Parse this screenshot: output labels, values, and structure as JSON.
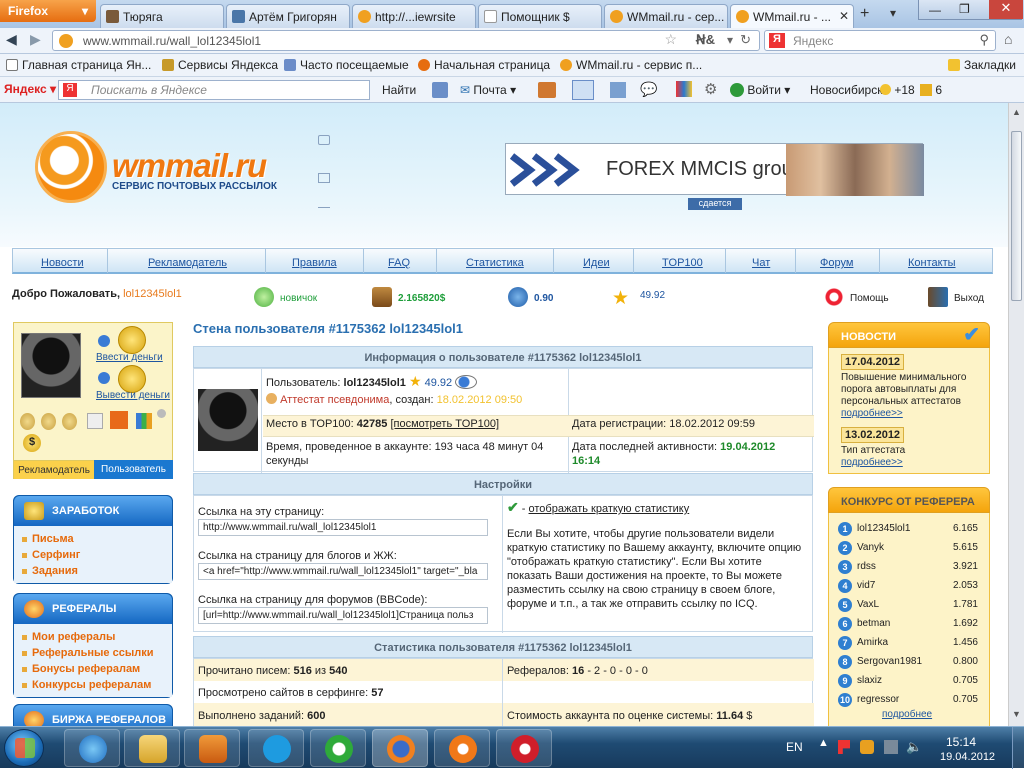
{
  "browser": {
    "app_button": "Firefox",
    "tabs": [
      {
        "label": "Тюряга",
        "icon_color": "#7a5a3a"
      },
      {
        "label": "Артём Григорян",
        "icon_color": "#4a76a8"
      },
      {
        "label": "http://...iewrsite",
        "icon_color": "#f0a020"
      },
      {
        "label": "Помощник $",
        "icon_color": "#ffffff"
      },
      {
        "label": "WMmail.ru - сер...",
        "icon_color": "#f0a020"
      },
      {
        "label": "WMmail.ru - ...",
        "icon_color": "#f0a020"
      }
    ],
    "url": "www.wmmail.ru/wall_lol12345lol1",
    "search_placeholder": "Яндекс",
    "bookmarks": [
      "Главная страница Ян...",
      "Сервисы Яндекса",
      "Часто посещаемые",
      "Начальная страница",
      "WMmail.ru - сервис п...",
      "Закладки"
    ],
    "yandex_bar": {
      "brand": "Яндекс",
      "search_placeholder": "Поискать в Яндексе",
      "find": "Найти",
      "mail": "Почта",
      "login": "Войти",
      "city": "Новосибирск",
      "temperature": "+18",
      "count": "6"
    }
  },
  "site": {
    "logo": "wmmail.ru",
    "logo_subtitle": "СЕРВИС ПОЧТОВЫХ РАССЫЛОК",
    "banner_text": "FOREX MMCIS group",
    "banner_tag": "сдается",
    "menu": [
      "Новости",
      "Рекламодатель",
      "Правила",
      "FAQ",
      "Статистика",
      "Идеи",
      "TOP100",
      "Чат",
      "Форум",
      "Контакты"
    ],
    "welcome": "Добро Пожаловать,",
    "username": "lol12345lol1",
    "stats": [
      {
        "text": "новичок",
        "color": "#1e9e3a",
        "icon": "novice-icon"
      },
      {
        "text": "2.165820$",
        "color": "#1e9e3a",
        "icon": "chest-icon"
      },
      {
        "text": "0.90",
        "color": "#1e55a0",
        "icon": "credits-icon"
      },
      {
        "text": "49.92",
        "color": "#1e55a0",
        "icon": "star-icon"
      }
    ],
    "help": "Помощь",
    "exit": "Выход"
  },
  "leftcol": {
    "deposit": "Ввести деньги",
    "withdraw": "Вывести деньги",
    "tab_adv": "Рекламодатель",
    "tab_user": "Пользователь",
    "earn": {
      "title": "ЗАРАБОТОК",
      "items": [
        "Письма",
        "Серфинг",
        "Задания"
      ]
    },
    "refs": {
      "title": "РЕФЕРАЛЫ",
      "items": [
        "Мои рефералы",
        "Реферальные ссылки",
        "Бонусы рефералам",
        "Конкурсы рефералам"
      ]
    },
    "exchange": {
      "title": "БИРЖА РЕФЕРАЛОВ"
    }
  },
  "main": {
    "title": "Стена пользователя #1175362 lol12345lol1",
    "info_header": "Информация о пользователе #1175362 lol12345lol1",
    "user_label": "Пользователь:",
    "user_name": "lol12345lol1",
    "user_rating": "49.92",
    "attestat": "Аттестат псевдонима",
    "created_label": ", создан:",
    "created": "18.02.2012 09:50",
    "place_label": "Место в TOP100:",
    "place": "42785",
    "place_link": "[посмотреть TOP100]",
    "reg_label": "Дата регистрации:",
    "reg_date": "18.02.2012 09:59",
    "time_text": "Время, проведенное в аккаунте: 193 часа 48 минут 04 секунды",
    "last_label": "Дата последней активности:",
    "last_date": "19.04.2012",
    "last_time": "16:14",
    "settings_header": "Настройки",
    "link_page_label": "Ссылка на эту страницу:",
    "link_page": "http://www.wmmail.ru/wall_lol12345lol1",
    "link_blog_label": "Ссылка на страницу для блогов и ЖЖ:",
    "link_blog": "<a href=\"http://www.wmmail.ru/wall_lol12345lol1\" target=\"_bla",
    "link_forum_label": "Ссылка на страницу для форумов (BBCode):",
    "link_forum": "[url=http://www.wmmail.ru/wall_lol12345lol1]Страница польз",
    "short_stats_link": "отображать краткую статистику",
    "short_stats_desc": "Если Вы хотите, чтобы другие пользователи видели краткую статистику по Вашему аккаунту, включите опцию \"отображать краткую статистику\". Если Вы хотите показать Ваши достижения на проекте, то Вы можете разместить ссылку на свою страницу в своем блоге, форуме и т.п., а так же отправить ссылку по ICQ.",
    "stats_header": "Статистика пользователя #1175362 lol12345lol1",
    "read_label": "Прочитано писем:",
    "read": "516",
    "read_of": "из",
    "read_total": "540",
    "refs_label": "Рефералов:",
    "refs": "16",
    "refs_rest": "- 2 - 0 - 0 - 0",
    "surf_label": "Просмотрено сайтов в серфинге:",
    "surf": "57",
    "tasks_label": "Выполнено заданий:",
    "tasks": "600",
    "value_label": "Стоимость аккаунта по оценке системы:",
    "value": "11.64",
    "value_unit": "$"
  },
  "rightcol": {
    "news_title": "НОВОСТИ",
    "news": [
      {
        "date": "17.04.2012",
        "text": "Повышение минимального порога автовыплаты для персональных аттестатов",
        "more": "подробнее>>"
      },
      {
        "date": "13.02.2012",
        "text": "Тип аттестата",
        "more": "подробнее>>"
      }
    ],
    "contest_title": "КОНКУРС ОТ РЕФЕРЕРА",
    "ranking": [
      {
        "n": "1",
        "name": "lol12345lol1",
        "score": "6.165"
      },
      {
        "n": "2",
        "name": "Vanyk",
        "score": "5.615"
      },
      {
        "n": "3",
        "name": "rdss",
        "score": "3.921"
      },
      {
        "n": "4",
        "name": "vid7",
        "score": "2.053"
      },
      {
        "n": "5",
        "name": "VaxL",
        "score": "1.781"
      },
      {
        "n": "6",
        "name": "betman",
        "score": "1.692"
      },
      {
        "n": "7",
        "name": "Amirka",
        "score": "1.456"
      },
      {
        "n": "8",
        "name": "Sergovan1981",
        "score": "0.800"
      },
      {
        "n": "9",
        "name": "slaxiz",
        "score": "0.705"
      },
      {
        "n": "10",
        "name": "regressor",
        "score": "0.705"
      }
    ],
    "more": "подробнее"
  },
  "taskbar": {
    "lang": "EN",
    "time": "15:14",
    "date": "19.04.2012"
  }
}
